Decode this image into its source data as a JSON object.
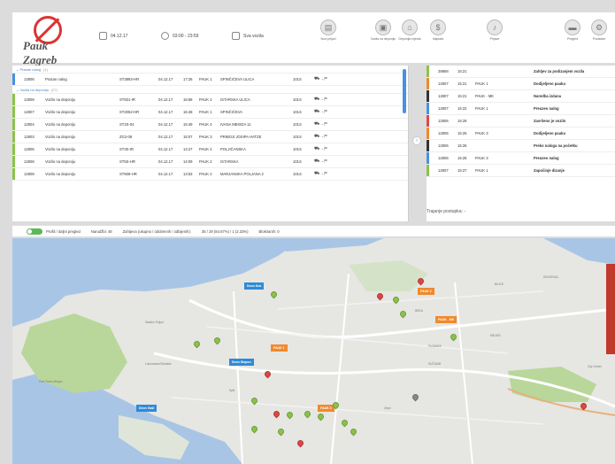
{
  "logo": {
    "text": "Pauk Zagreb"
  },
  "toolbar": {
    "date": "04.12.17",
    "time_range": "03:00 - 23:59",
    "vehicles_filter": "Sva vozila",
    "tools": [
      {
        "label": "Novi prijavi",
        "icon": "clipboard-icon"
      },
      {
        "label": "Vozila na deponiju",
        "icon": "car-icon"
      },
      {
        "label": "Deponija mjesta",
        "icon": "building-icon"
      },
      {
        "label": "Naplata",
        "icon": "dollar-icon"
      },
      {
        "label": "Prijave",
        "icon": "bell-icon"
      },
      {
        "label": "Pregled",
        "icon": "truck-icon"
      },
      {
        "label": "Postavke",
        "icon": "gear-icon"
      }
    ]
  },
  "left_panel": {
    "groups": [
      {
        "title": "Prazan nalog",
        "count": "(1)"
      },
      {
        "title": "Vozila na deponiju",
        "count": "(27)"
      }
    ],
    "rows": [
      {
        "id": "12806",
        "status": "Prazan nalog",
        "plate": "ST3893-HR",
        "date": "04.12.17",
        "time": "17:26",
        "truck": "PAUK 1",
        "address": "SPINČIĆEVA ULICA",
        "code": "101S",
        "color": "#4a90e2",
        "group": 0
      },
      {
        "id": "12808",
        "status": "Vozilo na deponiju",
        "plate": "ST831-IR",
        "date": "04.12.17",
        "time": "16:58",
        "truck": "PAUK 4",
        "address": "ISTARSKA ULICA",
        "code": "101S",
        "color": "#8bc34a",
        "group": 1
      },
      {
        "id": "12807",
        "status": "Vozilo na deponiju",
        "plate": "ST2052-HR",
        "date": "04.12.17",
        "time": "16:48",
        "truck": "PAUK 1",
        "address": "SPINČIĆEVA",
        "code": "101S",
        "color": "#8bc34a",
        "group": 1
      },
      {
        "id": "12804",
        "status": "Vozilo na deponiju",
        "plate": "ST2S-04",
        "date": "04.12.17",
        "time": "15:49",
        "truck": "PAUK 4",
        "address": "IVANA MEKIDA 11",
        "code": "101S",
        "color": "#8bc34a",
        "group": 1
      },
      {
        "id": "12803",
        "status": "Vozilo na deponiju",
        "plate": "ZG2-08",
        "date": "04.12.17",
        "time": "15:07",
        "truck": "PAUK 3",
        "address": "PRIBOJI JOSIPA HATZE",
        "code": "101S",
        "color": "#8bc34a",
        "group": 1
      },
      {
        "id": "12806",
        "status": "Vozilo na deponiju",
        "plate": "ST3S-IR",
        "date": "04.12.17",
        "time": "14:27",
        "truck": "PAUK 4",
        "address": "POLJIČANSKA",
        "code": "101S",
        "color": "#8bc34a",
        "group": 1
      },
      {
        "id": "12808",
        "status": "Vozilo na deponiju",
        "plate": "ST5S-HR",
        "date": "04.12.17",
        "time": "14:09",
        "truck": "PAUK 2",
        "address": "ISTARSKA",
        "code": "101S",
        "color": "#8bc34a",
        "group": 1
      },
      {
        "id": "12808",
        "status": "Vozilo na deponiju",
        "plate": "ST508-HR",
        "date": "04.12.17",
        "time": "13:53",
        "truck": "PAUK 2",
        "address": "MARJANSKA POLJANA 2",
        "code": "101S",
        "color": "#8bc34a",
        "group": 1
      }
    ]
  },
  "right_panel": {
    "rows": [
      {
        "id": "28868",
        "time": "15:21",
        "truck": "",
        "event": "Zahtjev za podizanjem vozila",
        "color": "#8bc34a"
      },
      {
        "id": "12807",
        "time": "15:21",
        "truck": "PAUK 1",
        "event": "Dodijeljeno pauku",
        "color": "#f0892c"
      },
      {
        "id": "12807",
        "time": "15:21",
        "truck": "PAUK - MK",
        "event": "Naredba izdana",
        "color": "#333333"
      },
      {
        "id": "12807",
        "time": "15:22",
        "truck": "PAUK 1",
        "event": "Preuzeo nalog",
        "color": "#4a90e2"
      },
      {
        "id": "12806",
        "time": "15:26",
        "truck": "",
        "event": "Završeno je vozilo",
        "color": "#e04545"
      },
      {
        "id": "12806",
        "time": "15:26",
        "truck": "PAUK 3",
        "event": "Dodijeljeno pauku",
        "color": "#f0892c"
      },
      {
        "id": "12806",
        "time": "15:26",
        "truck": "",
        "event": "Preko naloga na početku",
        "color": "#333333"
      },
      {
        "id": "12806",
        "time": "15:26",
        "truck": "PAUK 3",
        "event": "Preuzeo nalog",
        "color": "#4a90e2"
      },
      {
        "id": "12807",
        "time": "15:27",
        "truck": "PAUK 1",
        "event": "Započinje dizanje",
        "color": "#8bc34a"
      }
    ],
    "duration_label": "Trajanje postupka:",
    "duration_value": "-"
  },
  "statusbar": {
    "toggle_label": "Prošli / daljni pregled",
    "item1": "Narudžbi: 48",
    "item2": "Zahtjeva (ukupno / odobrenih / odbijenih):",
    "item2_value": "35 / 29 (84.67%) / 1 (2.33%)",
    "item3": "Blokiranih: 0"
  },
  "map": {
    "labels": {
      "vrh": "Vrh Marjana",
      "park": "Park Šuma Marjan",
      "split": "Split",
      "dracevac": "DRAČEVAC",
      "bilice": "BILICE",
      "brda": "BRDA",
      "pujanke": "PUJANKE",
      "mejasi": "MEJAŠI",
      "sucidar": "SUČIDAR",
      "city": "City Center",
      "stadion": "Stadion Poljud",
      "lukoran": "Lukoranska Rivalska",
      "gripe": "Gripe",
      "kanal": "Kaštelanski zaljev"
    },
    "parkings_blue": [
      "Deon Kuk",
      "Deon Stepon",
      "Deon Gašl"
    ],
    "parkings_orange": [
      "PAUK 2",
      "PAUK - MK",
      "PAUK 3",
      "PAUK 1"
    ]
  }
}
